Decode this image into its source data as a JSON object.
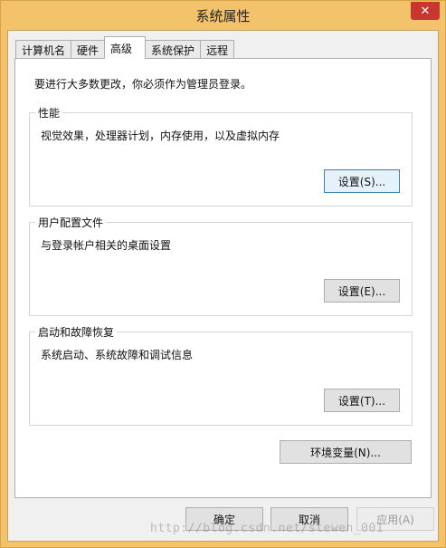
{
  "window": {
    "title": "系统属性",
    "close_symbol": "✕"
  },
  "tabs": [
    {
      "label": "计算机名",
      "active": false
    },
    {
      "label": "硬件",
      "active": false
    },
    {
      "label": "高级",
      "active": true
    },
    {
      "label": "系统保护",
      "active": false
    },
    {
      "label": "远程",
      "active": false
    }
  ],
  "advanced": {
    "intro": "要进行大多数更改，你必须作为管理员登录。",
    "performance": {
      "label": "性能",
      "description": "视觉效果，处理器计划，内存使用，以及虚拟内存",
      "button": "设置(S)..."
    },
    "user_profiles": {
      "label": "用户配置文件",
      "description": "与登录帐户相关的桌面设置",
      "button": "设置(E)..."
    },
    "startup_recovery": {
      "label": "启动和故障恢复",
      "description": "系统启动、系统故障和调试信息",
      "button": "设置(T)..."
    },
    "env_button": "环境变量(N)..."
  },
  "footer": {
    "ok": "确定",
    "cancel": "取消",
    "apply": "应用(A)"
  },
  "watermark": "http://blog.csdn.net/stewen_001"
}
